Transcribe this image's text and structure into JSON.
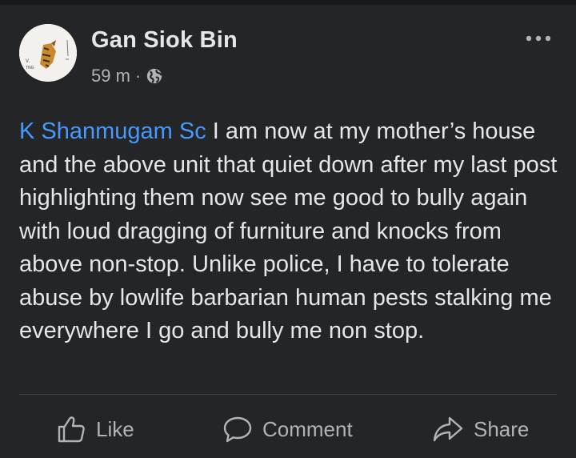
{
  "post": {
    "author": "Gan Siok Bin",
    "timestamp": "59 m",
    "separator": "·",
    "privacy_icon": "globe-icon",
    "mention": "K Shanmugam Sc",
    "body": " I am now at my mother’s house and the above unit that quiet down after my last post highlighting them now see me good to bully again with loud dragging of furniture and knocks from above non-stop. Unlike police, I have to tolerate abuse by lowlife barbarian human pests stalking me everywhere I go and bully me non stop."
  },
  "actions": {
    "like_label": "Like",
    "comment_label": "Comment",
    "share_label": "Share"
  },
  "colors": {
    "background": "#242526",
    "text": "#e4e6eb",
    "secondary_text": "#b0b3b8",
    "mention": "#4599ff"
  }
}
